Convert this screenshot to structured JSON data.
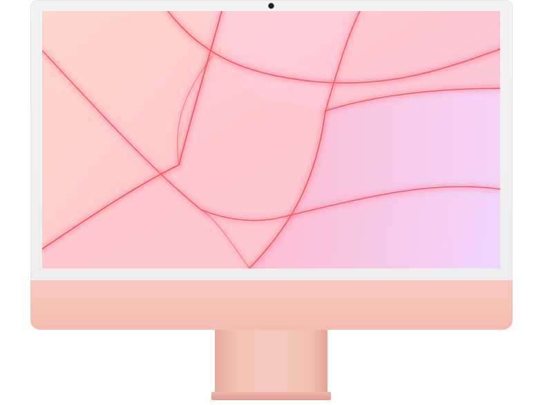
{
  "image": {
    "subject": "imac-24-inch",
    "colors": {
      "body": "#f5c2b8",
      "bezel": "#f0f0f0",
      "screen_accent": "#ff6f78",
      "screen_background": "#f9c3c6"
    }
  }
}
